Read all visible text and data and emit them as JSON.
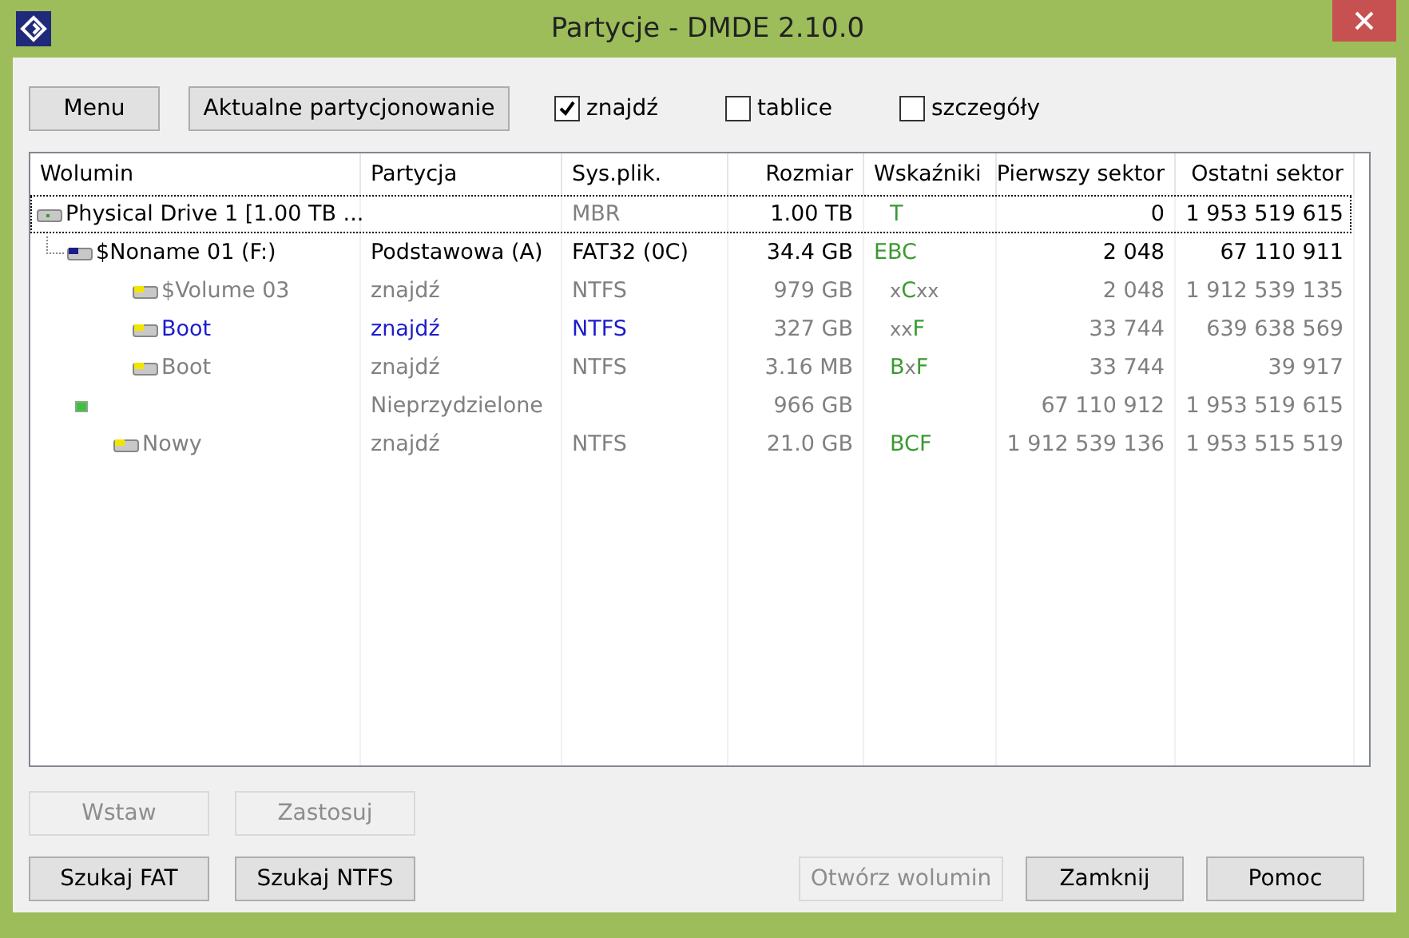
{
  "window": {
    "title": "Partycje - DMDE 2.10.0"
  },
  "toolbar": {
    "buttons": [
      {
        "label": "Menu"
      },
      {
        "label": "Aktualne partycjonowanie"
      }
    ],
    "checkboxes": [
      {
        "label": "znajdź",
        "checked": true
      },
      {
        "label": "tablice",
        "checked": false
      },
      {
        "label": "szczegóły",
        "checked": false
      }
    ]
  },
  "table": {
    "columns": [
      "Wolumin",
      "Partycja",
      "Sys.plik.",
      "Rozmiar",
      "Wskaźniki",
      "Pierwszy sektor",
      "Ostatni sektor"
    ],
    "rows": [
      {
        "kind": "physical",
        "highlighted": false,
        "focused": true,
        "name": "Physical Drive 1 [1.00 TB ...",
        "fs": "MBR",
        "size": "1.00 TB",
        "flags": [
          {
            "text": "T",
            "on": true
          }
        ],
        "first": "0",
        "last": "1 953 519 615",
        "children": [
          {
            "kind": "partition",
            "highlighted": false,
            "focused": false,
            "name": "$Noname 01 (F:)",
            "partition": "Podstawowa (A)",
            "fs": "FAT32 (0C)",
            "size": "34.4 GB",
            "flags": [
              {
                "text": "EBC",
                "on": true
              }
            ],
            "first": "2 048",
            "last": "67 110 911",
            "children": [
              {
                "kind": "found",
                "highlighted": false,
                "focused": false,
                "name": "$Volume 03",
                "partition": "znajdź",
                "fs": "NTFS",
                "size": "979 GB",
                "flags": [
                  {
                    "text": "x",
                    "on": false
                  },
                  {
                    "text": "C",
                    "on": true
                  },
                  {
                    "text": "xx",
                    "on": false
                  }
                ],
                "first": "2 048",
                "last": "1 912 539 135"
              },
              {
                "kind": "found",
                "highlighted": true,
                "focused": false,
                "name": "Boot",
                "partition": "znajdź",
                "fs": "NTFS",
                "size": "327 GB",
                "flags": [
                  {
                    "text": "xx",
                    "on": false
                  },
                  {
                    "text": "F",
                    "on": true
                  }
                ],
                "first": "33 744",
                "last": "639 638 569"
              },
              {
                "kind": "found",
                "highlighted": false,
                "focused": false,
                "name": "Boot",
                "partition": "znajdź",
                "fs": "NTFS",
                "size": "3.16 MB",
                "flags": [
                  {
                    "text": "B",
                    "on": true
                  },
                  {
                    "text": "x",
                    "on": false
                  },
                  {
                    "text": "F",
                    "on": true
                  }
                ],
                "first": "33 744",
                "last": "39 917"
              }
            ]
          },
          {
            "kind": "unallocated",
            "highlighted": false,
            "focused": false,
            "partition": "Nieprzydzielone",
            "size": "966 GB",
            "first": "67 110 912",
            "last": "1 953 519 615"
          },
          {
            "kind": "found",
            "highlighted": false,
            "focused": false,
            "name": "Nowy",
            "partition": "znajdź",
            "fs": "NTFS",
            "size": "21.0 GB",
            "flags": [
              {
                "text": "BCF",
                "on": true
              }
            ],
            "first": "1 912 539 136",
            "last": "1 953 515 519"
          }
        ]
      }
    ]
  },
  "bottom_left": [
    [
      {
        "label": "Wstaw",
        "disabled": true
      },
      {
        "label": "Zastosuj",
        "disabled": true
      }
    ],
    [
      {
        "label": "Szukaj FAT",
        "disabled": false
      },
      {
        "label": "Szukaj NTFS",
        "disabled": false
      }
    ]
  ],
  "bottom_right": [
    {
      "label": "Otwórz wolumin",
      "disabled": true
    },
    {
      "label": "Zamknij",
      "disabled": false
    },
    {
      "label": "Pomoc",
      "disabled": false
    }
  ]
}
